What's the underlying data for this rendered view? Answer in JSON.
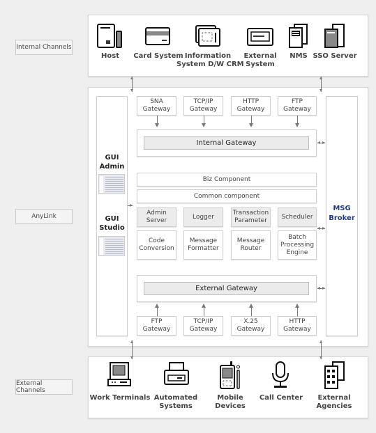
{
  "channels": {
    "internal": "Internal Channels",
    "anylink": "AnyLink",
    "external": "External Channels"
  },
  "internal_systems": [
    {
      "label": "Host",
      "icon": "host-icon"
    },
    {
      "label": "Card System",
      "icon": "card-icon"
    },
    {
      "label": "Information\nSystem D/W CRM",
      "icon": "information-system-icon"
    },
    {
      "label": "External\nSystem",
      "icon": "external-system-icon"
    },
    {
      "label": "NMS",
      "icon": "nms-icon"
    },
    {
      "label": "SSO Server",
      "icon": "server-icon"
    }
  ],
  "gui": {
    "admin": "GUI\nAdmin",
    "studio": "GUI\nStudio"
  },
  "broker": {
    "label": "MSG\nBroker",
    "color": "#1f3a8a"
  },
  "top_gateways": [
    "SNA\nGateway",
    "TCP/IP\nGateway",
    "HTTP\nGateway",
    "FTP\nGateway"
  ],
  "internal_gateway": "Internal Gateway",
  "biz_component": "Biz Component",
  "common_component": "Common component",
  "components_row1": [
    "Admin\nServer",
    "Logger",
    "Transaction\nParameter",
    "Scheduler"
  ],
  "components_row2": [
    "Code\nConversion",
    "Message\nFormatter",
    "Message\nRouter",
    "Batch\nProcessing\nEngine"
  ],
  "external_gateway": "External Gateway",
  "bottom_gateways": [
    "FTP\nGateway",
    "TCP/IP\nGateway",
    "X.25\nGateway",
    "HTTP\nGateway"
  ],
  "external_systems": [
    {
      "label": "Work Terminals",
      "icon": "terminal-icon"
    },
    {
      "label": "Automated\nSystems",
      "icon": "automated-system-icon"
    },
    {
      "label": "Mobile\nDevices",
      "icon": "mobile-icon"
    },
    {
      "label": "Call Center",
      "icon": "microphone-icon"
    },
    {
      "label": "External\nAgencies",
      "icon": "building-icon"
    }
  ]
}
